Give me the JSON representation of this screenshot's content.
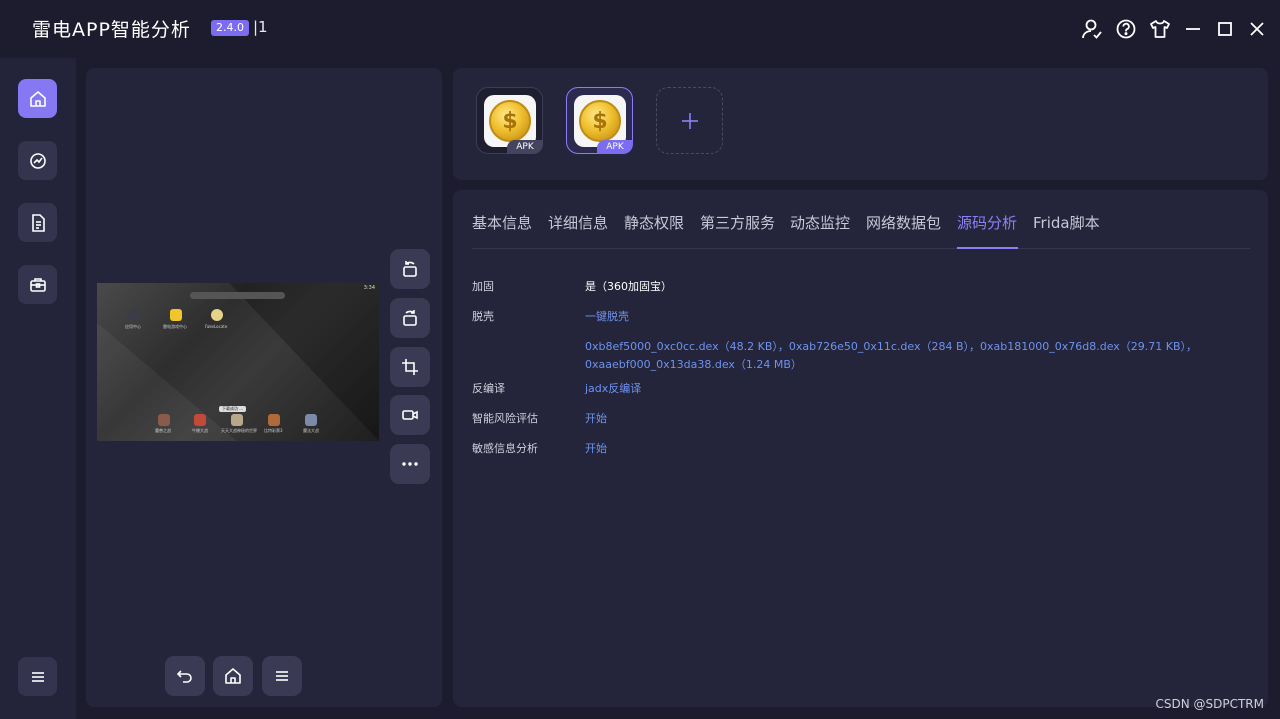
{
  "titlebar": {
    "title": "雷电APP智能分析",
    "version": "2.4.0",
    "suffix": "|1",
    "icons": [
      "user-check-icon",
      "help-icon",
      "shirt-icon",
      "minimize-icon",
      "maximize-icon",
      "close-icon"
    ]
  },
  "nav": {
    "items": [
      {
        "icon": "home-icon",
        "active": true
      },
      {
        "icon": "analytics-icon",
        "active": false
      },
      {
        "icon": "document-icon",
        "active": false
      },
      {
        "icon": "toolbox-icon",
        "active": false
      }
    ],
    "menu_icon": "menu-icon"
  },
  "device": {
    "screen": {
      "status_time": "3:34",
      "apps_top": [
        "应用中心",
        "雷电游戏中心",
        "FakeLocate"
      ],
      "apps_dock": [
        "魔兽之战",
        "牛棚大战",
        "天天大战神秘的世界",
        "比特彩票3",
        "魔法大战"
      ],
      "toast": "下载成功 ..."
    },
    "side_tools": [
      "rotate-left-icon",
      "rotate-right-icon",
      "crop-icon",
      "record-icon",
      "more-icon"
    ],
    "bottom_tools": [
      "back-icon",
      "home-icon",
      "menu-icon"
    ]
  },
  "apk": {
    "items": [
      {
        "tag": "APK",
        "selected": false
      },
      {
        "tag": "APK",
        "selected": true
      }
    ],
    "add_label": "+"
  },
  "tabs": [
    "基本信息",
    "详细信息",
    "静态权限",
    "第三方服务",
    "动态监控",
    "网络数据包",
    "源码分析",
    "Frida脚本"
  ],
  "active_tab": "源码分析",
  "details": {
    "packing_label": "加固",
    "packing_value": "是（360加固宝）",
    "unpack_label": "脱壳",
    "unpack_link": "一键脱壳",
    "dex_line1": "0xb8ef5000_0xc0cc.dex（48.2 KB），0xab726e50_0x11c.dex（284 B），0xab181000_0x76d8.dex（29.71 KB），",
    "dex_line2": "0xaaebf000_0x13da38.dex（1.24 MB）",
    "decompile_label": "反编译",
    "decompile_link": "jadx反编译",
    "risk_label": "智能风险评估",
    "risk_link": "开始",
    "sensitive_label": "敏感信息分析",
    "sensitive_link": "开始"
  },
  "watermark": "CSDN @SDPCTRM",
  "colors": {
    "accent": "#8677f3",
    "link": "#6d93ef",
    "background": "#1c1c2e",
    "panel": "#24243a"
  }
}
